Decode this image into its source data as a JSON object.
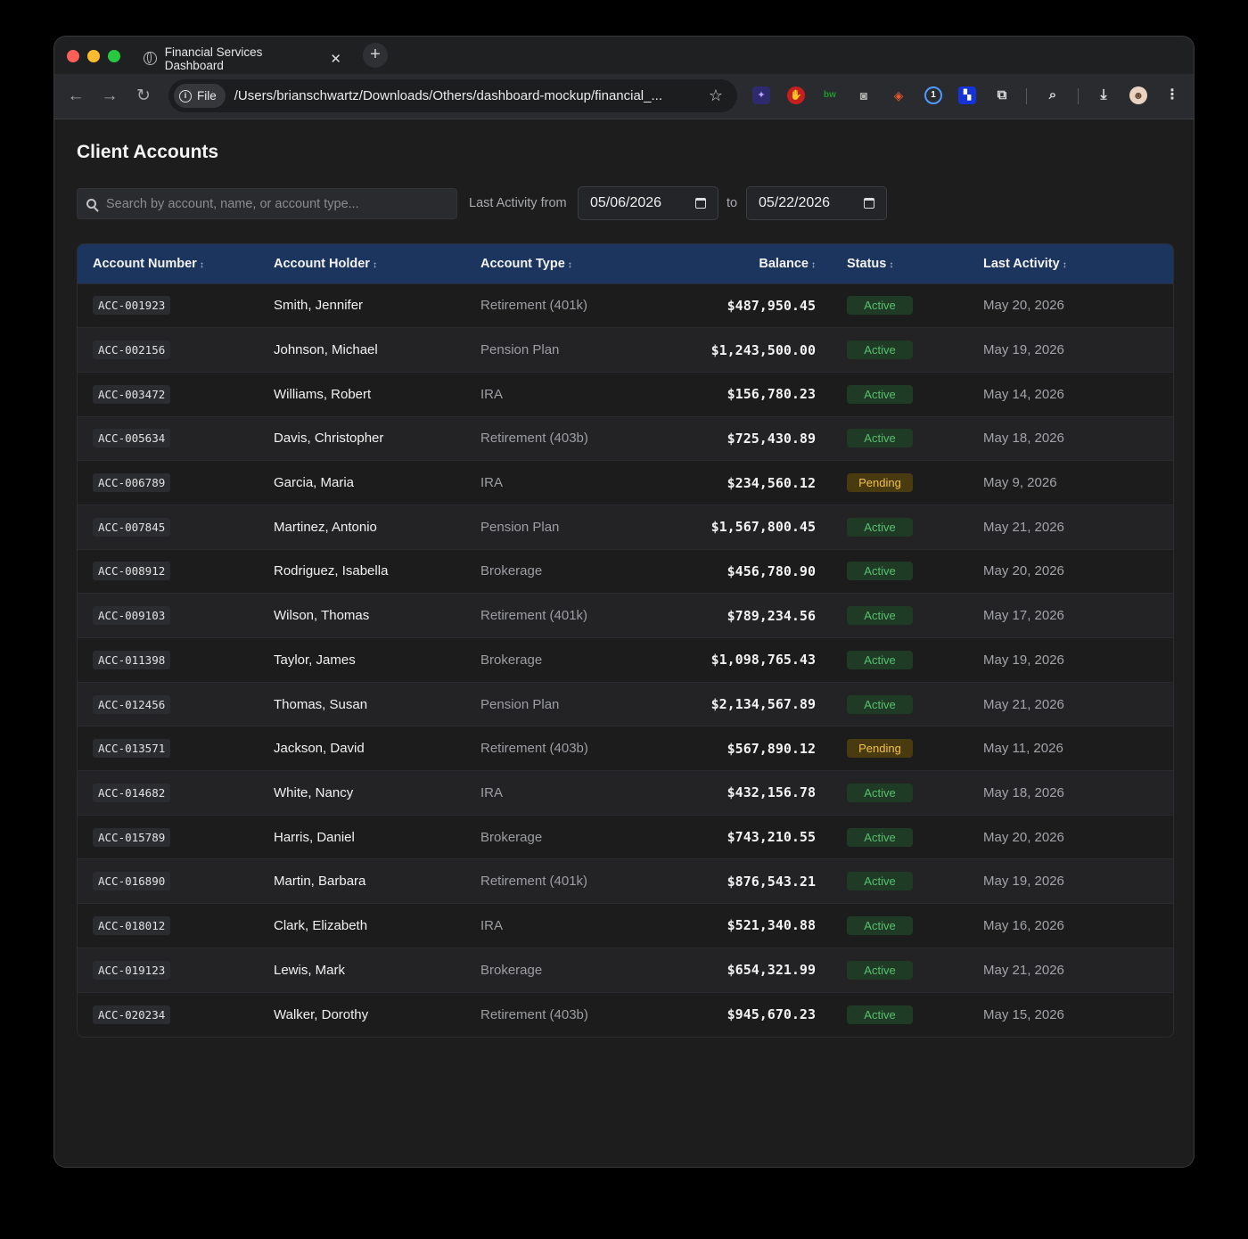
{
  "browser": {
    "tab_title": "Financial Services Dashboard",
    "tab_close": "✕",
    "new_tab": "+",
    "chip_label": "File",
    "url": "/Users/brianschwartz/Downloads/Others/dashboard-mockup/financial_...",
    "back": "←",
    "forward": "→",
    "reload": "↻",
    "bookmark": "☆"
  },
  "page": {
    "title": "Client Accounts",
    "search_placeholder": "Search by account, name, or account type...",
    "from_label": "Last Activity from",
    "from_date": "05/06/2026",
    "to_label": "to",
    "to_date": "05/22/2026"
  },
  "table": {
    "headers": [
      "Account Number",
      "Account Holder",
      "Account Type",
      "Balance",
      "Status",
      "Last Activity"
    ],
    "sort_glyph": "↕",
    "rows": [
      {
        "acct": "ACC-001923",
        "holder": "Smith, Jennifer",
        "type": "Retirement (401k)",
        "balance": "$487,950.45",
        "status": "Active",
        "date": "May 20, 2026"
      },
      {
        "acct": "ACC-002156",
        "holder": "Johnson, Michael",
        "type": "Pension Plan",
        "balance": "$1,243,500.00",
        "status": "Active",
        "date": "May 19, 2026"
      },
      {
        "acct": "ACC-003472",
        "holder": "Williams, Robert",
        "type": "IRA",
        "balance": "$156,780.23",
        "status": "Active",
        "date": "May 14, 2026"
      },
      {
        "acct": "ACC-005634",
        "holder": "Davis, Christopher",
        "type": "Retirement (403b)",
        "balance": "$725,430.89",
        "status": "Active",
        "date": "May 18, 2026"
      },
      {
        "acct": "ACC-006789",
        "holder": "Garcia, Maria",
        "type": "IRA",
        "balance": "$234,560.12",
        "status": "Pending",
        "date": "May 9, 2026"
      },
      {
        "acct": "ACC-007845",
        "holder": "Martinez, Antonio",
        "type": "Pension Plan",
        "balance": "$1,567,800.45",
        "status": "Active",
        "date": "May 21, 2026"
      },
      {
        "acct": "ACC-008912",
        "holder": "Rodriguez, Isabella",
        "type": "Brokerage",
        "balance": "$456,780.90",
        "status": "Active",
        "date": "May 20, 2026"
      },
      {
        "acct": "ACC-009103",
        "holder": "Wilson, Thomas",
        "type": "Retirement (401k)",
        "balance": "$789,234.56",
        "status": "Active",
        "date": "May 17, 2026"
      },
      {
        "acct": "ACC-011398",
        "holder": "Taylor, James",
        "type": "Brokerage",
        "balance": "$1,098,765.43",
        "status": "Active",
        "date": "May 19, 2026"
      },
      {
        "acct": "ACC-012456",
        "holder": "Thomas, Susan",
        "type": "Pension Plan",
        "balance": "$2,134,567.89",
        "status": "Active",
        "date": "May 21, 2026"
      },
      {
        "acct": "ACC-013571",
        "holder": "Jackson, David",
        "type": "Retirement (403b)",
        "balance": "$567,890.12",
        "status": "Pending",
        "date": "May 11, 2026"
      },
      {
        "acct": "ACC-014682",
        "holder": "White, Nancy",
        "type": "IRA",
        "balance": "$432,156.78",
        "status": "Active",
        "date": "May 18, 2026"
      },
      {
        "acct": "ACC-015789",
        "holder": "Harris, Daniel",
        "type": "Brokerage",
        "balance": "$743,210.55",
        "status": "Active",
        "date": "May 20, 2026"
      },
      {
        "acct": "ACC-016890",
        "holder": "Martin, Barbara",
        "type": "Retirement (401k)",
        "balance": "$876,543.21",
        "status": "Active",
        "date": "May 19, 2026"
      },
      {
        "acct": "ACC-018012",
        "holder": "Clark, Elizabeth",
        "type": "IRA",
        "balance": "$521,340.88",
        "status": "Active",
        "date": "May 16, 2026"
      },
      {
        "acct": "ACC-019123",
        "holder": "Lewis, Mark",
        "type": "Brokerage",
        "balance": "$654,321.99",
        "status": "Active",
        "date": "May 21, 2026"
      },
      {
        "acct": "ACC-020234",
        "holder": "Walker, Dorothy",
        "type": "Retirement (403b)",
        "balance": "$945,670.23",
        "status": "Active",
        "date": "May 15, 2026"
      }
    ]
  },
  "colors": {
    "header_bg": "#1c355e",
    "active_text": "#58c06e",
    "pending_text": "#f0c045"
  }
}
